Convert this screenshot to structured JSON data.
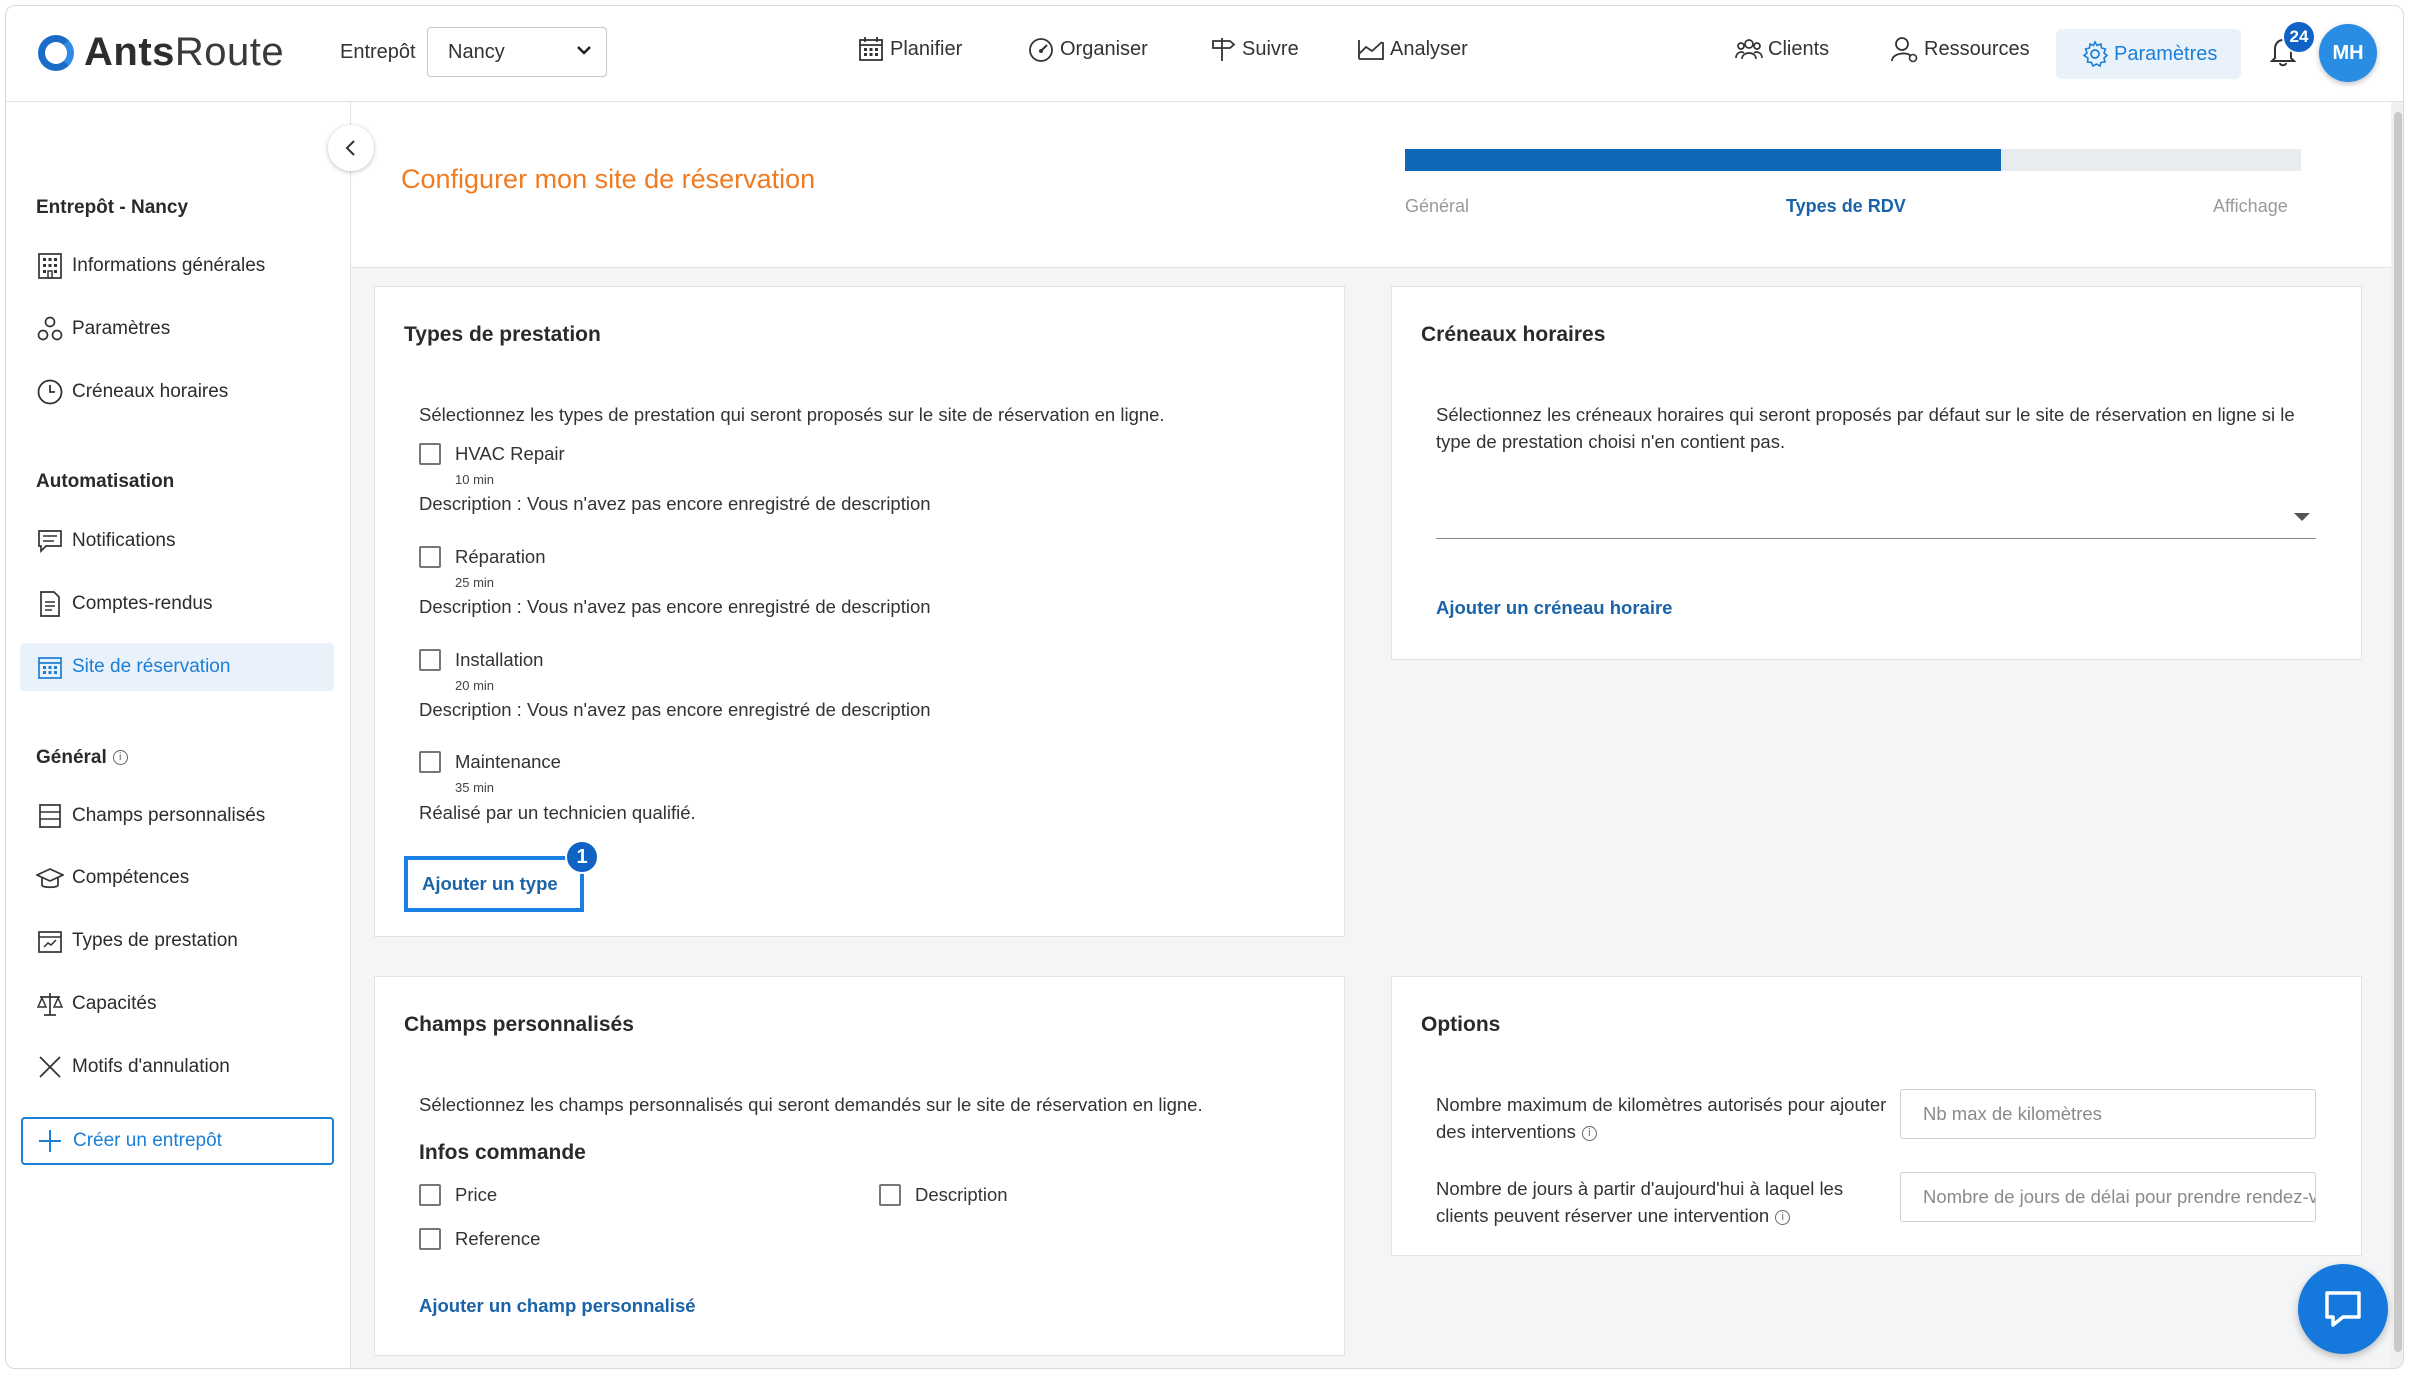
{
  "header": {
    "logo_text_bold": "Ants",
    "logo_text_light": "Route",
    "warehouse_label": "Entrepôt",
    "warehouse_value": "Nancy",
    "nav": [
      "Planifier",
      "Organiser",
      "Suivre",
      "Analyser"
    ],
    "right_nav": [
      "Clients",
      "Ressources",
      "Paramètres"
    ],
    "notification_count": "24",
    "avatar_initials": "MH"
  },
  "sidebar": {
    "section1_title": "Entrepôt - Nancy",
    "section1_items": [
      "Informations générales",
      "Paramètres",
      "Créneaux horaires"
    ],
    "section2_title": "Automatisation",
    "section2_items": [
      "Notifications",
      "Comptes-rendus",
      "Site de réservation"
    ],
    "section3_title": "Général",
    "section3_items": [
      "Champs personnalisés",
      "Compétences",
      "Types de prestation",
      "Capacités",
      "Motifs d'annulation"
    ],
    "create_button": "Créer un entrepôt"
  },
  "page": {
    "title": "Configurer mon site de réservation",
    "progress_fraction": 0.665,
    "steps": [
      "Général",
      "Types de RDV",
      "Affichage"
    ]
  },
  "prestation_card": {
    "title": "Types de prestation",
    "intro": "Sélectionnez les types de prestation qui seront proposés sur le site de réservation en ligne.",
    "types": [
      {
        "name": "HVAC Repair",
        "duration": "10 min",
        "description": "Description : Vous n'avez pas encore enregistré de description"
      },
      {
        "name": "Réparation",
        "duration": "25 min",
        "description": "Description : Vous n'avez pas encore enregistré de description"
      },
      {
        "name": "Installation",
        "duration": "20 min",
        "description": "Description : Vous n'avez pas encore enregistré de description"
      },
      {
        "name": "Maintenance",
        "duration": "35 min",
        "description": "Réalisé par un technicien qualifié."
      }
    ],
    "add_link": "Ajouter un type",
    "step_badge": "1"
  },
  "slots_card": {
    "title": "Créneaux horaires",
    "intro": "Sélectionnez les créneaux horaires qui seront proposés par défaut sur le site de réservation en ligne si le type de prestation choisi n'en contient pas.",
    "add_link": "Ajouter un créneau horaire"
  },
  "custom_card": {
    "title": "Champs personnalisés",
    "intro": "Sélectionnez les champs personnalisés qui seront demandés sur le site de réservation en ligne.",
    "group_title": "Infos commande",
    "fields": [
      "Price",
      "Description",
      "Reference"
    ],
    "add_link": "Ajouter un champ personnalisé"
  },
  "options_card": {
    "title": "Options",
    "km_label": "Nombre maximum de kilomètres autorisés pour ajouter des interventions",
    "km_placeholder": "Nb max de kilomètres",
    "days_label": "Nombre de jours à partir d'aujourd'hui à laquel les clients peuvent réserver une intervention",
    "days_placeholder": "Nombre de jours de délai pour prendre rendez-vous"
  },
  "colors": {
    "accent": "#1c7fd6",
    "title_orange": "#ef7b22",
    "progress": "#1068b8"
  }
}
